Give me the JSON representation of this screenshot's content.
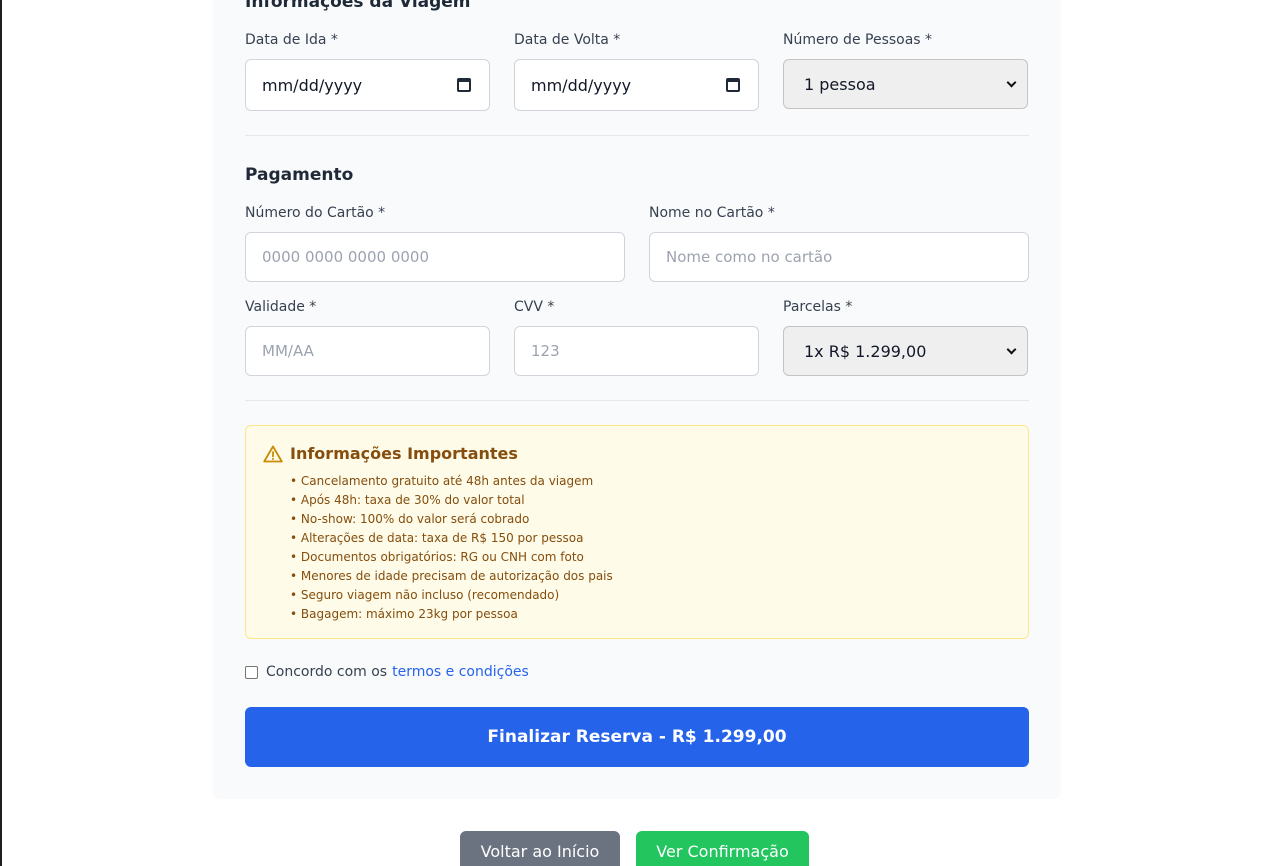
{
  "trip": {
    "section_title": "Informações da Viagem",
    "date_out_label": "Data de Ida *",
    "date_out_value": "mm/dd/yyyy",
    "date_back_label": "Data de Volta *",
    "date_back_value": "mm/dd/yyyy",
    "people_label": "Número de Pessoas *",
    "people_selected": "1 pessoa"
  },
  "payment": {
    "section_title": "Pagamento",
    "card_number_label": "Número do Cartão *",
    "card_number_placeholder": "0000 0000 0000 0000",
    "card_name_label": "Nome no Cartão *",
    "card_name_placeholder": "Nome como no cartão",
    "expiry_label": "Validade *",
    "expiry_placeholder": "MM/AA",
    "cvv_label": "CVV *",
    "cvv_placeholder": "123",
    "installments_label": "Parcelas *",
    "installments_selected": "1x R$ 1.299,00"
  },
  "notice": {
    "title": "Informações Importantes",
    "icon": "warning-triangle-icon",
    "items": [
      "• Cancelamento gratuito até 48h antes da viagem",
      "• Após 48h: taxa de 30% do valor total",
      "• No-show: 100% do valor será cobrado",
      "• Alterações de data: taxa de R$ 150 por pessoa",
      "• Documentos obrigatórios: RG ou CNH com foto",
      "• Menores de idade precisam de autorização dos pais",
      "• Seguro viagem não incluso (recomendado)",
      "• Bagagem: máximo 23kg por pessoa"
    ]
  },
  "terms": {
    "text": "Concordo com os",
    "link": "termos e condições"
  },
  "submit_label": "Finalizar Reserva - R$ 1.299,00",
  "footer": {
    "back_label": "Voltar ao Início",
    "confirm_label": "Ver Confirmação"
  },
  "colors": {
    "primary": "#2563eb",
    "success": "#22c55e",
    "secondary": "#6b7280",
    "notice_bg": "#fefce8",
    "notice_text": "#854d0e"
  }
}
